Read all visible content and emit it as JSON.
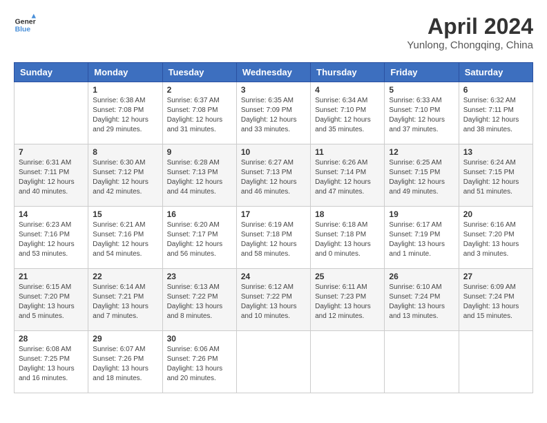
{
  "header": {
    "logo_line1": "General",
    "logo_line2": "Blue",
    "month_year": "April 2024",
    "location": "Yunlong, Chongqing, China"
  },
  "days_of_week": [
    "Sunday",
    "Monday",
    "Tuesday",
    "Wednesday",
    "Thursday",
    "Friday",
    "Saturday"
  ],
  "weeks": [
    [
      {
        "day": "",
        "info": ""
      },
      {
        "day": "1",
        "info": "Sunrise: 6:38 AM\nSunset: 7:08 PM\nDaylight: 12 hours\nand 29 minutes."
      },
      {
        "day": "2",
        "info": "Sunrise: 6:37 AM\nSunset: 7:08 PM\nDaylight: 12 hours\nand 31 minutes."
      },
      {
        "day": "3",
        "info": "Sunrise: 6:35 AM\nSunset: 7:09 PM\nDaylight: 12 hours\nand 33 minutes."
      },
      {
        "day": "4",
        "info": "Sunrise: 6:34 AM\nSunset: 7:10 PM\nDaylight: 12 hours\nand 35 minutes."
      },
      {
        "day": "5",
        "info": "Sunrise: 6:33 AM\nSunset: 7:10 PM\nDaylight: 12 hours\nand 37 minutes."
      },
      {
        "day": "6",
        "info": "Sunrise: 6:32 AM\nSunset: 7:11 PM\nDaylight: 12 hours\nand 38 minutes."
      }
    ],
    [
      {
        "day": "7",
        "info": "Sunrise: 6:31 AM\nSunset: 7:11 PM\nDaylight: 12 hours\nand 40 minutes."
      },
      {
        "day": "8",
        "info": "Sunrise: 6:30 AM\nSunset: 7:12 PM\nDaylight: 12 hours\nand 42 minutes."
      },
      {
        "day": "9",
        "info": "Sunrise: 6:28 AM\nSunset: 7:13 PM\nDaylight: 12 hours\nand 44 minutes."
      },
      {
        "day": "10",
        "info": "Sunrise: 6:27 AM\nSunset: 7:13 PM\nDaylight: 12 hours\nand 46 minutes."
      },
      {
        "day": "11",
        "info": "Sunrise: 6:26 AM\nSunset: 7:14 PM\nDaylight: 12 hours\nand 47 minutes."
      },
      {
        "day": "12",
        "info": "Sunrise: 6:25 AM\nSunset: 7:15 PM\nDaylight: 12 hours\nand 49 minutes."
      },
      {
        "day": "13",
        "info": "Sunrise: 6:24 AM\nSunset: 7:15 PM\nDaylight: 12 hours\nand 51 minutes."
      }
    ],
    [
      {
        "day": "14",
        "info": "Sunrise: 6:23 AM\nSunset: 7:16 PM\nDaylight: 12 hours\nand 53 minutes."
      },
      {
        "day": "15",
        "info": "Sunrise: 6:21 AM\nSunset: 7:16 PM\nDaylight: 12 hours\nand 54 minutes."
      },
      {
        "day": "16",
        "info": "Sunrise: 6:20 AM\nSunset: 7:17 PM\nDaylight: 12 hours\nand 56 minutes."
      },
      {
        "day": "17",
        "info": "Sunrise: 6:19 AM\nSunset: 7:18 PM\nDaylight: 12 hours\nand 58 minutes."
      },
      {
        "day": "18",
        "info": "Sunrise: 6:18 AM\nSunset: 7:18 PM\nDaylight: 13 hours\nand 0 minutes."
      },
      {
        "day": "19",
        "info": "Sunrise: 6:17 AM\nSunset: 7:19 PM\nDaylight: 13 hours\nand 1 minute."
      },
      {
        "day": "20",
        "info": "Sunrise: 6:16 AM\nSunset: 7:20 PM\nDaylight: 13 hours\nand 3 minutes."
      }
    ],
    [
      {
        "day": "21",
        "info": "Sunrise: 6:15 AM\nSunset: 7:20 PM\nDaylight: 13 hours\nand 5 minutes."
      },
      {
        "day": "22",
        "info": "Sunrise: 6:14 AM\nSunset: 7:21 PM\nDaylight: 13 hours\nand 7 minutes."
      },
      {
        "day": "23",
        "info": "Sunrise: 6:13 AM\nSunset: 7:22 PM\nDaylight: 13 hours\nand 8 minutes."
      },
      {
        "day": "24",
        "info": "Sunrise: 6:12 AM\nSunset: 7:22 PM\nDaylight: 13 hours\nand 10 minutes."
      },
      {
        "day": "25",
        "info": "Sunrise: 6:11 AM\nSunset: 7:23 PM\nDaylight: 13 hours\nand 12 minutes."
      },
      {
        "day": "26",
        "info": "Sunrise: 6:10 AM\nSunset: 7:24 PM\nDaylight: 13 hours\nand 13 minutes."
      },
      {
        "day": "27",
        "info": "Sunrise: 6:09 AM\nSunset: 7:24 PM\nDaylight: 13 hours\nand 15 minutes."
      }
    ],
    [
      {
        "day": "28",
        "info": "Sunrise: 6:08 AM\nSunset: 7:25 PM\nDaylight: 13 hours\nand 16 minutes."
      },
      {
        "day": "29",
        "info": "Sunrise: 6:07 AM\nSunset: 7:26 PM\nDaylight: 13 hours\nand 18 minutes."
      },
      {
        "day": "30",
        "info": "Sunrise: 6:06 AM\nSunset: 7:26 PM\nDaylight: 13 hours\nand 20 minutes."
      },
      {
        "day": "",
        "info": ""
      },
      {
        "day": "",
        "info": ""
      },
      {
        "day": "",
        "info": ""
      },
      {
        "day": "",
        "info": ""
      }
    ]
  ]
}
